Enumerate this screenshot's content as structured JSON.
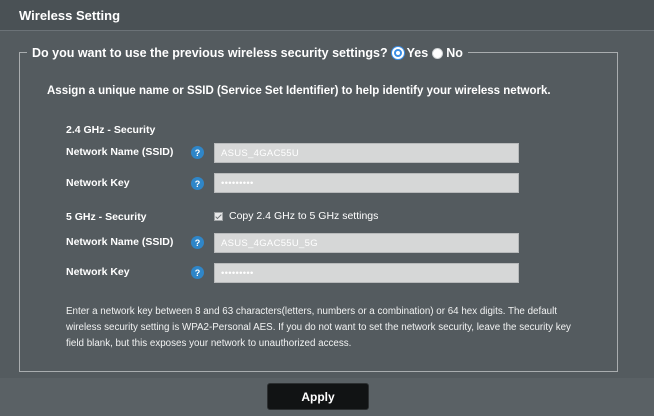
{
  "header": {
    "title": "Wireless Setting"
  },
  "question": {
    "text": "Do you want to use the previous wireless security settings?",
    "yes_label": "Yes",
    "no_label": "No",
    "selected": "Yes"
  },
  "intro": "Assign a unique name or SSID (Service Set Identifier) to help identify your wireless network.",
  "band24": {
    "title": "2.4 GHz - Security",
    "ssid_label": "Network Name (SSID)",
    "ssid_value": "ASUS_4GAC55U",
    "key_label": "Network Key",
    "key_value": "•••••••••"
  },
  "band5": {
    "title": "5 GHz - Security",
    "copy_label": "Copy 2.4 GHz to 5 GHz settings",
    "ssid_label": "Network Name (SSID)",
    "ssid_value": "ASUS_4GAC55U_5G",
    "key_label": "Network Key",
    "key_value": "•••••••••"
  },
  "help_glyph": "?",
  "note": "Enter a network key between 8 and 63 characters(letters, numbers or a combination) or 64 hex digits. The default wireless security setting is WPA2-Personal AES. If you do not want to set the network security, leave the security key field blank, but this exposes your network to unauthorized access.",
  "apply_label": "Apply",
  "colors": {
    "background": "#545b5f",
    "field": "#d6d7d7",
    "help": "#2f86c8",
    "radio_selected": "#3a8ee6",
    "button": "#111314"
  },
  "icons": {
    "help": "question-mark-help-icon",
    "radio": "radio-button",
    "checkbox": "checkbox-checked"
  }
}
